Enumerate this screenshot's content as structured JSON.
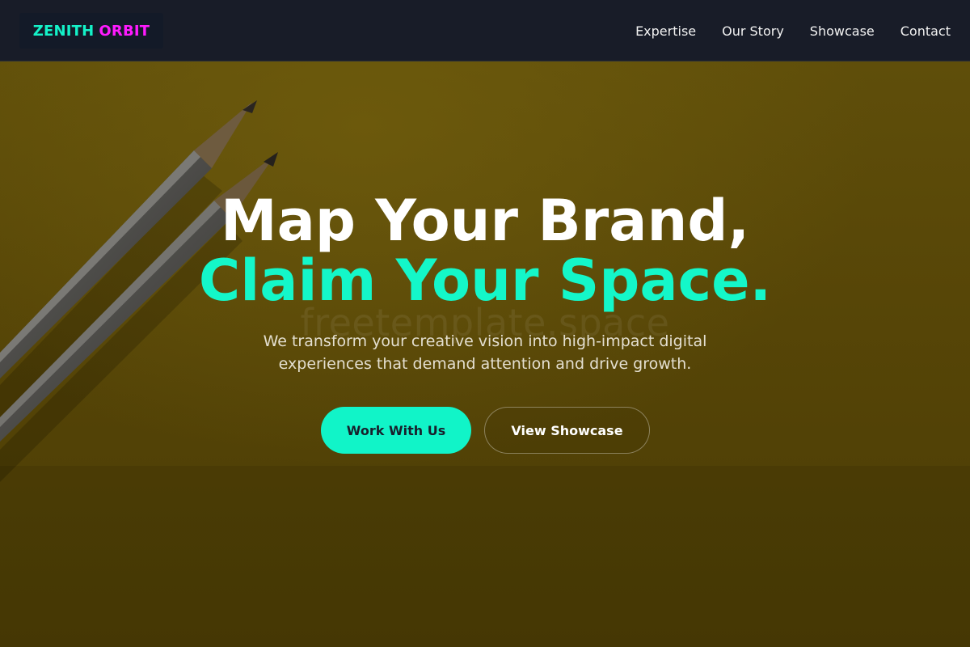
{
  "navbar": {
    "logo": {
      "part1": "ZENITH",
      "part2": "ORBIT"
    },
    "links": [
      "Expertise",
      "Our Story",
      "Showcase",
      "Contact"
    ]
  },
  "hero": {
    "watermark": "freetemplate.space",
    "headline_line1": "Map Your Brand,",
    "headline_line2": "Claim Your Space.",
    "subtitle": "We transform your creative vision into high-impact digital experiences that demand attention and drive growth.",
    "primary_button": "Work With Us",
    "secondary_button": "View Showcase"
  },
  "colors": {
    "accent_teal": "#14f7c9",
    "accent_magenta": "#ff1aff",
    "navbar_bg": "#181c28",
    "hero_bg": "#574607"
  },
  "icons": [
    "pencil-image"
  ]
}
